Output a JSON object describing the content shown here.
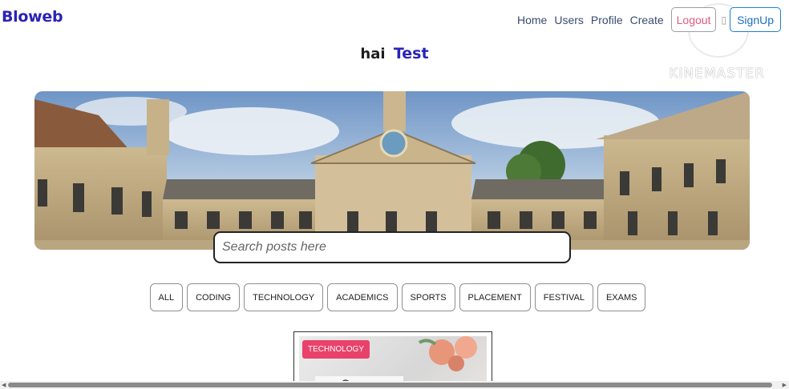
{
  "brand": "Bloweb",
  "nav": {
    "links": [
      "Home",
      "Users",
      "Profile",
      "Create"
    ],
    "logout_label": "Logout",
    "signup_label": "SignUp"
  },
  "greeting": {
    "prefix": "hai",
    "username": "Test"
  },
  "watermark": "KINEMASTER",
  "search": {
    "placeholder": "Search posts here",
    "value": ""
  },
  "categories": [
    "ALL",
    "CODING",
    "TECHNOLOGY",
    "ACADEMICS",
    "SPORTS",
    "PLACEMENT",
    "FESTIVAL",
    "EXAMS"
  ],
  "posts": [
    {
      "category": "TECHNOLOGY"
    }
  ],
  "colors": {
    "brand": "#2a23b8",
    "badge": "#e8426a",
    "signup_border": "#1b7fd6"
  }
}
